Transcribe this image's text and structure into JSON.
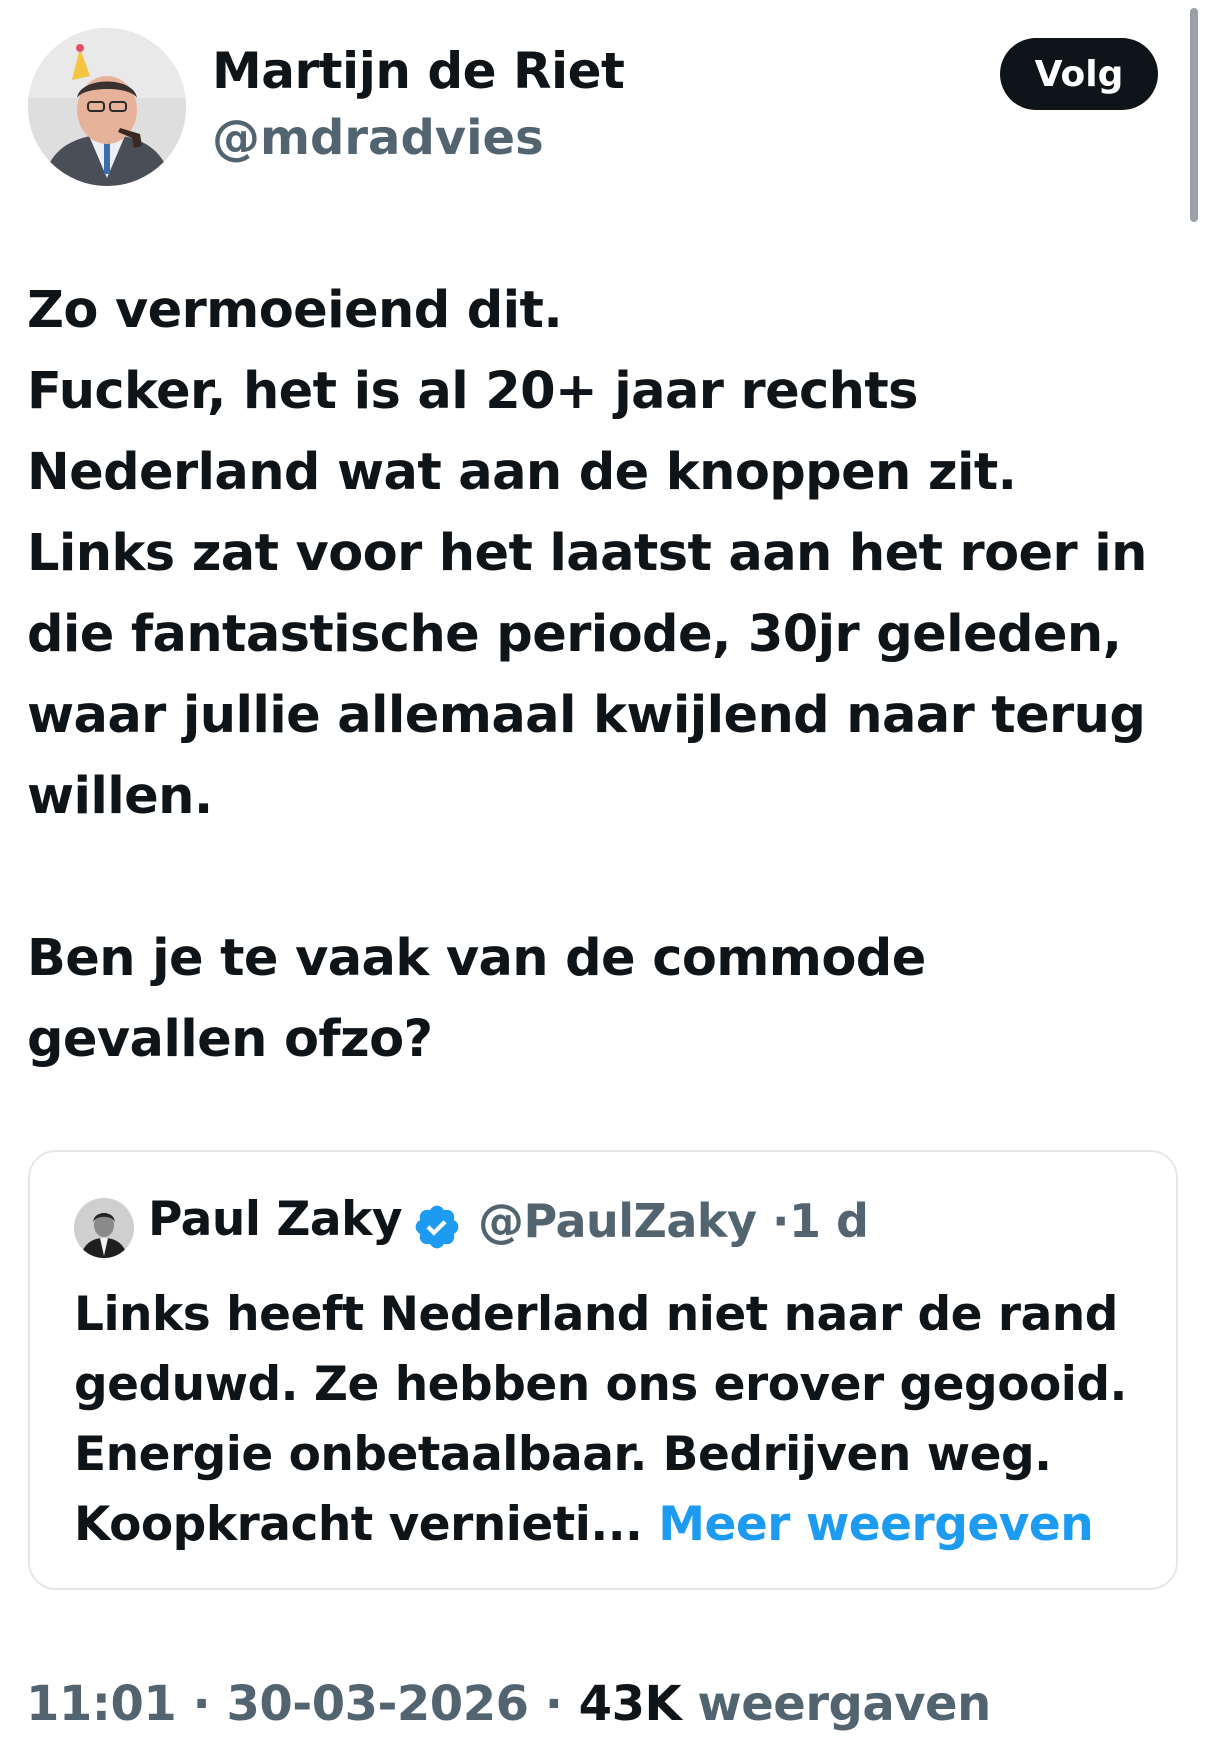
{
  "author": {
    "name": "Martijn de Riet",
    "handle": "@mdradvies"
  },
  "follow_button": {
    "label": "Volg"
  },
  "tweet": {
    "lines": [
      "Zo vermoeiend dit.",
      "Fucker, het is al 20+ jaar rechts",
      "Nederland wat aan de knoppen zit.",
      "Links zat voor het laatst aan het roer in",
      "die fantastische periode, 30jr geleden,",
      "waar jullie allemaal kwijlend naar terug",
      "willen.",
      "Ben je te vaak van de commode",
      "gevallen ofzo?"
    ]
  },
  "quote": {
    "name": "Paul Zaky",
    "verified_icon": "verified-badge-icon",
    "handle": "@PaulZaky",
    "separator": "·",
    "time": "1 d",
    "lines": [
      "Links heeft Nederland niet naar de rand",
      "geduwd. Ze hebben ons erover gegooid.",
      "Energie onbetaalbaar. Bedrijven weg.",
      "Koopkracht vernieti..."
    ],
    "more_label": "Meer weergeven"
  },
  "footer": {
    "time": "11:01",
    "separator": "·",
    "date": "30-03-2026",
    "views_count": "43K",
    "views_label": "weergaven"
  },
  "colors": {
    "text": "#0f1419",
    "secondary": "#536471",
    "link": "#1d9bf0",
    "verified": "#1d9bf0",
    "border": "#e4e7ea"
  }
}
